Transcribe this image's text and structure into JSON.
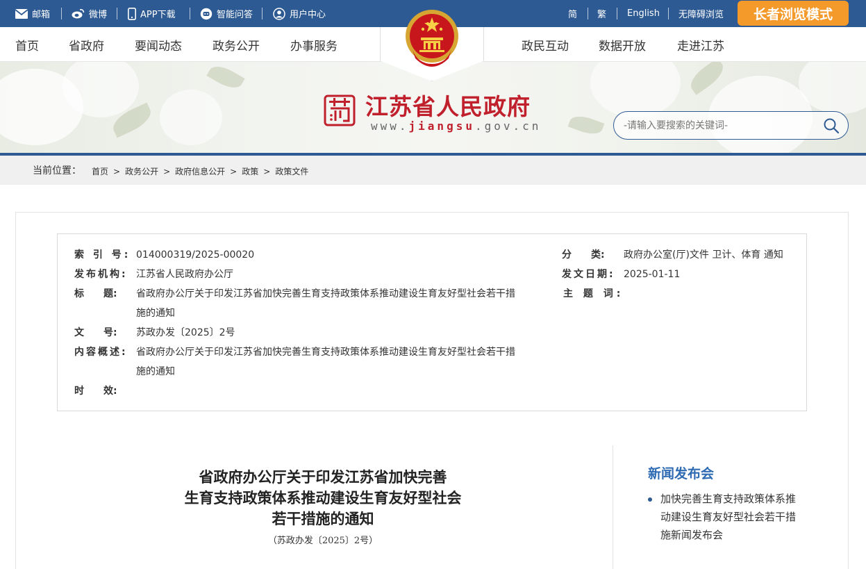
{
  "topbar": {
    "left_links": [
      {
        "label": "邮箱",
        "icon": "mail-icon"
      },
      {
        "label": "微博",
        "icon": "weibo-icon"
      },
      {
        "label": "APP下载",
        "icon": "phone-icon"
      },
      {
        "label": "智能问答",
        "icon": "chat-robot-icon"
      },
      {
        "label": "用户中心",
        "icon": "user-icon"
      }
    ],
    "right_links": [
      "简",
      "繁",
      "English",
      "无障碍浏览"
    ],
    "elder_mode": "长者浏览模式"
  },
  "nav": {
    "left": [
      "首页",
      "省政府",
      "要闻动态",
      "政务公开",
      "办事服务"
    ],
    "right": [
      "政民互动",
      "数据开放",
      "走进江苏"
    ]
  },
  "logo": {
    "title": "江苏省人民政府",
    "url_prefix": "www.",
    "url_domain": "jiangsu",
    "url_suffix": ".gov.cn"
  },
  "search": {
    "placeholder": "-请输入要搜索的关键词-"
  },
  "breadcrumb": {
    "label": "当前位置：",
    "items": [
      "首页",
      "政务公开",
      "政府信息公开",
      "政策",
      "政策文件"
    ]
  },
  "meta": {
    "index_label": "索 引 号:",
    "index_value": "014000319/2025-00020",
    "category_label": "分　　类:",
    "category_value": "政府办公室(厅)文件 卫计、体育 通知",
    "publisher_label": "发布机构:",
    "publisher_value": "江苏省人民政府办公厅",
    "date_label": "发文日期:",
    "date_value": "2025-01-11",
    "title_label": "标　　题:",
    "title_value_line1": "省政府办公厅关于印发江苏省加快完善生育支持政策体系推动建设生育友好型社会若干措",
    "title_value_line2": "施的通知",
    "subject_label": "主 题 词:",
    "subject_value": "",
    "docno_label": "文　　号:",
    "docno_value": "苏政办发〔2025〕2号",
    "summary_label": "内容概述:",
    "summary_value_line1": "省政府办公厅关于印发江苏省加快完善生育支持政策体系推动建设生育友好型社会若干措",
    "summary_value_line2": "施的通知",
    "validity_label": "时　　效:",
    "validity_value": ""
  },
  "document": {
    "title_line1": "省政府办公厅关于印发江苏省加快完善",
    "title_line2": "生育支持政策体系推动建设生育友好型社会",
    "title_line3": "若干措施的通知",
    "number": "（苏政办发〔2025〕2号）"
  },
  "sidebar": {
    "title": "新闻发布会",
    "items": [
      "加快完善生育支持政策体系推动建设生育友好型社会若干措施新闻发布会"
    ]
  },
  "colors": {
    "brand_blue": "#2e5a93",
    "logo_red": "#c01f2c",
    "elder_orange": "#f39a2a",
    "side_title_blue": "#2e6bb3"
  }
}
